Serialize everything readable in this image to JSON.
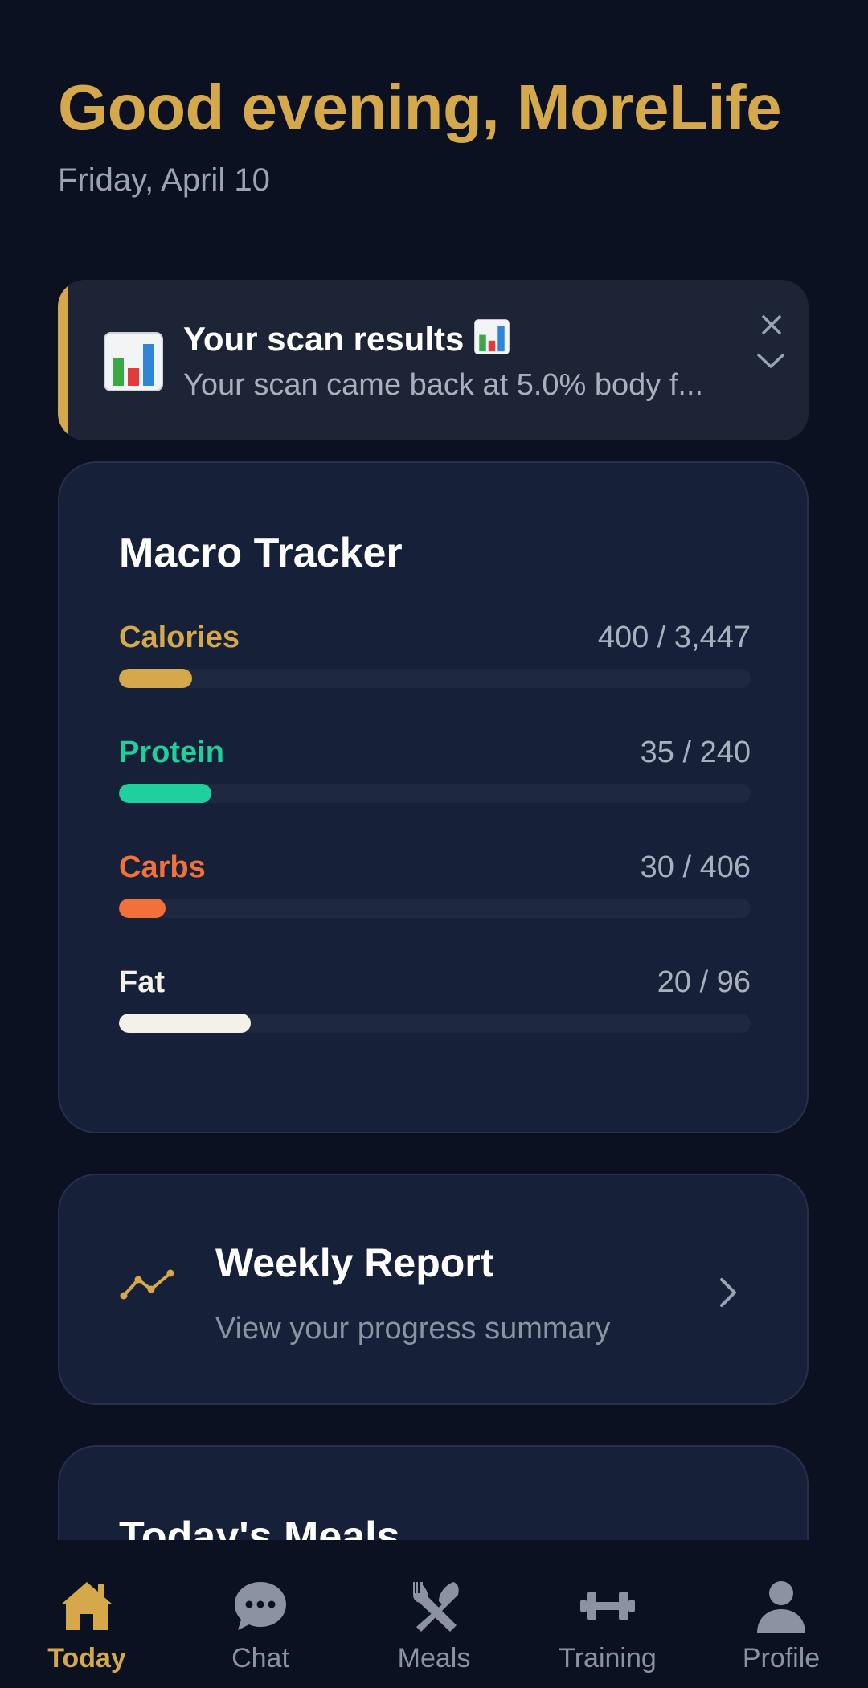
{
  "header": {
    "greeting": "Good evening, MoreLife",
    "date": "Friday, April 10"
  },
  "scan_banner": {
    "title": "Your scan results",
    "message": "Your scan came back at 5.0% body f...",
    "icon": "bar-chart-emoji-icon",
    "accent_color": "#d4a84b"
  },
  "macro_tracker": {
    "title": "Macro Tracker",
    "items": [
      {
        "label": "Calories",
        "consumed": 400,
        "goal": 3447,
        "display": "400 / 3,447",
        "color": "#d4a84b"
      },
      {
        "label": "Protein",
        "consumed": 35,
        "goal": 240,
        "display": "35 / 240",
        "color": "#1fcf9c"
      },
      {
        "label": "Carbs",
        "consumed": 30,
        "goal": 406,
        "display": "30 / 406",
        "color": "#f2703a"
      },
      {
        "label": "Fat",
        "consumed": 20,
        "goal": 96,
        "display": "20 / 96",
        "color": "#f4f1e8"
      }
    ]
  },
  "weekly_report": {
    "title": "Weekly Report",
    "subtitle": "View your progress summary",
    "icon": "trend-line-icon"
  },
  "meals": {
    "title": "Today's Meals"
  },
  "nav": {
    "active_color": "#d4a84b",
    "inactive_color": "#8b93a3",
    "items": [
      {
        "label": "Today",
        "icon": "home-icon",
        "active": true
      },
      {
        "label": "Chat",
        "icon": "chat-icon",
        "active": false
      },
      {
        "label": "Meals",
        "icon": "fork-knife-icon",
        "active": false
      },
      {
        "label": "Training",
        "icon": "dumbbell-icon",
        "active": false
      },
      {
        "label": "Profile",
        "icon": "profile-icon",
        "active": false
      }
    ]
  }
}
